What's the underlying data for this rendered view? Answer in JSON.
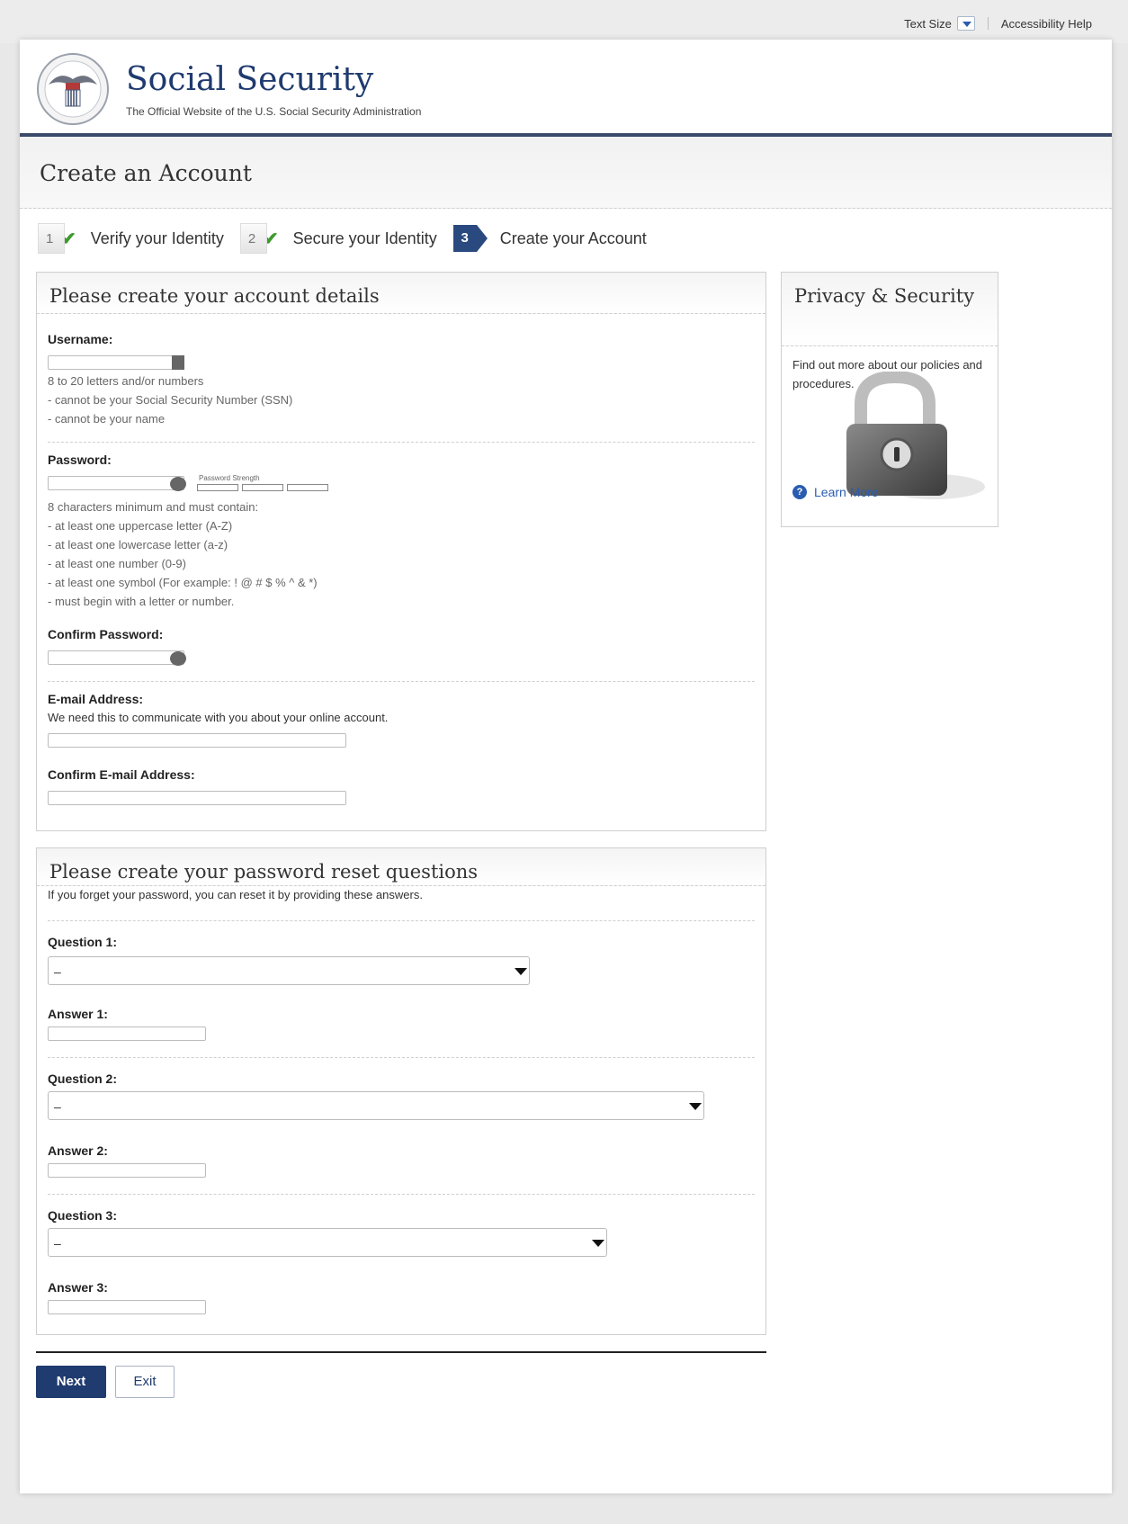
{
  "utility": {
    "text_size": "Text Size",
    "accessibility": "Accessibility Help"
  },
  "header": {
    "title": "Social Security",
    "subtitle": "The Official Website of the U.S. Social Security Administration"
  },
  "page_title": "Create an Account",
  "steps": [
    {
      "number": "1",
      "label": "Verify your Identity",
      "status": "complete"
    },
    {
      "number": "2",
      "label": "Secure your Identity",
      "status": "complete"
    },
    {
      "number": "3",
      "label": "Create your Account",
      "status": "current"
    }
  ],
  "account": {
    "heading": "Please create your account details",
    "username_label": "Username:",
    "username_hint": "8 to 20 letters and/or numbers\n- cannot be your Social Security Number (SSN)\n- cannot be your name",
    "password_label": "Password:",
    "password_strength": "Password Strength",
    "password_hint": "8 characters minimum and must contain:\n- at least one uppercase letter (A-Z)\n- at least one lowercase letter (a-z)\n- at least one number (0-9)\n- at least one symbol (For example: ! @ # $ % ^ & *)\n- must begin with a letter or number.",
    "confirm_password_label": "Confirm Password:",
    "email_label": "E-mail Address:",
    "email_hint": "We need this to communicate with you about your online account.",
    "confirm_email_label": "Confirm E-mail Address:"
  },
  "questions": {
    "heading": "Please create your password reset questions",
    "subheading": "If you forget your password, you can reset it by providing these answers.",
    "items": [
      {
        "question_label": "Question 1:",
        "selected": "–",
        "answer_label": "Answer 1:"
      },
      {
        "question_label": "Question 2:",
        "selected": "–",
        "answer_label": "Answer 2:"
      },
      {
        "question_label": "Question 3:",
        "selected": "–",
        "answer_label": "Answer 3:"
      }
    ]
  },
  "sidebar": {
    "heading": "Privacy & Security",
    "body": "Find out more about our policies and procedures.",
    "link": "Learn More"
  },
  "buttons": {
    "next": "Next",
    "exit": "Exit"
  },
  "colors": {
    "brand_navy": "#1f3b6f",
    "link_blue": "#2a5db0",
    "check_green": "#3d9a2b"
  }
}
